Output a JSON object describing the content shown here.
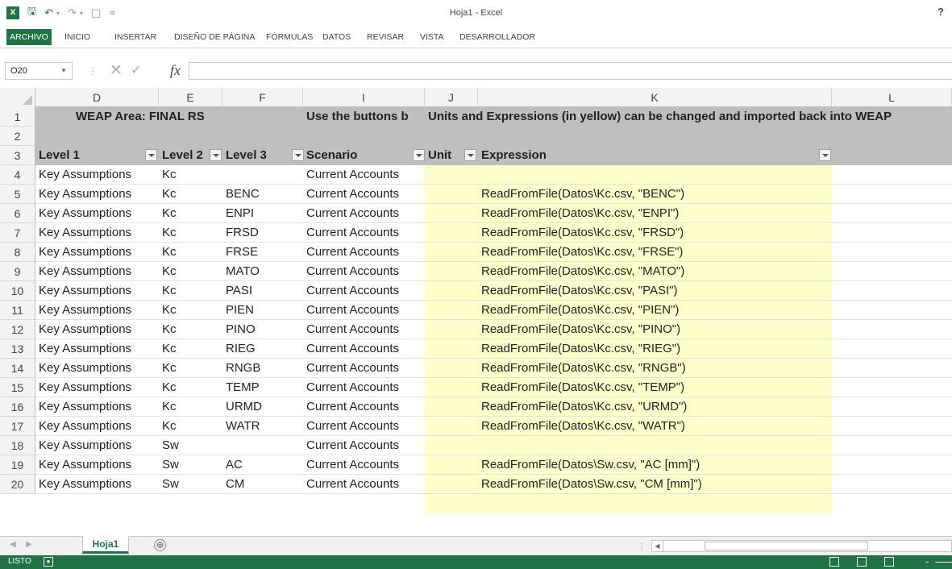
{
  "window": {
    "title": "Hoja1 - Excel",
    "help": "?",
    "logo": "X",
    "icons": [
      "save-icon",
      "undo-icon",
      "redo-icon",
      "new-document-icon",
      "customize-qat-icon"
    ]
  },
  "ribbon": {
    "tabs": [
      {
        "label": "ARCHIVO",
        "active": true
      },
      {
        "label": "INICIO"
      },
      {
        "label": "INSERTAR"
      },
      {
        "label": "DISEÑO DE PÁGINA"
      },
      {
        "label": "FÓRMULAS"
      },
      {
        "label": "DATOS"
      },
      {
        "label": "REVISAR"
      },
      {
        "label": "VISTA"
      },
      {
        "label": "DESARROLLADOR"
      }
    ]
  },
  "formula_bar": {
    "name_box": "O20",
    "fx": "fx",
    "value": ""
  },
  "columns": [
    "D",
    "E",
    "F",
    "I",
    "J",
    "K",
    "L"
  ],
  "rows": [
    {
      "n": "1",
      "cells": {
        "D": "WEAP Area: FINAL RS",
        "I": "Use the buttons b",
        "J": "Units and Expressions (in yellow) can be changed and imported back into WEAP"
      }
    },
    {
      "n": "2",
      "cells": {}
    },
    {
      "n": "3",
      "cells": {
        "D": "Level 1",
        "E": "Level 2",
        "F": "Level 3",
        "I": "Scenario",
        "J": "Unit",
        "K": "Expression"
      }
    },
    {
      "n": "4",
      "cells": {
        "D": "Key Assumptions",
        "E": "Kc",
        "F": "",
        "I": "Current Accounts",
        "K": ""
      }
    },
    {
      "n": "5",
      "cells": {
        "D": "Key Assumptions",
        "E": "Kc",
        "F": "BENC",
        "I": "Current Accounts",
        "K": "ReadFromFile(Datos\\Kc.csv, \"BENC\")"
      }
    },
    {
      "n": "6",
      "cells": {
        "D": "Key Assumptions",
        "E": "Kc",
        "F": "ENPI",
        "I": "Current Accounts",
        "K": "ReadFromFile(Datos\\Kc.csv, \"ENPI\")"
      }
    },
    {
      "n": "7",
      "cells": {
        "D": "Key Assumptions",
        "E": "Kc",
        "F": "FRSD",
        "I": "Current Accounts",
        "K": "ReadFromFile(Datos\\Kc.csv, \"FRSD\")"
      }
    },
    {
      "n": "8",
      "cells": {
        "D": "Key Assumptions",
        "E": "Kc",
        "F": "FRSE",
        "I": "Current Accounts",
        "K": "ReadFromFile(Datos\\Kc.csv, \"FRSE\")"
      }
    },
    {
      "n": "9",
      "cells": {
        "D": "Key Assumptions",
        "E": "Kc",
        "F": "MATO",
        "I": "Current Accounts",
        "K": "ReadFromFile(Datos\\Kc.csv, \"MATO\")"
      }
    },
    {
      "n": "10",
      "cells": {
        "D": "Key Assumptions",
        "E": "Kc",
        "F": "PASI",
        "I": "Current Accounts",
        "K": "ReadFromFile(Datos\\Kc.csv, \"PASI\")"
      }
    },
    {
      "n": "11",
      "cells": {
        "D": "Key Assumptions",
        "E": "Kc",
        "F": "PIEN",
        "I": "Current Accounts",
        "K": "ReadFromFile(Datos\\Kc.csv, \"PIEN\")"
      }
    },
    {
      "n": "12",
      "cells": {
        "D": "Key Assumptions",
        "E": "Kc",
        "F": "PINO",
        "I": "Current Accounts",
        "K": "ReadFromFile(Datos\\Kc.csv, \"PINO\")"
      }
    },
    {
      "n": "13",
      "cells": {
        "D": "Key Assumptions",
        "E": "Kc",
        "F": "RIEG",
        "I": "Current Accounts",
        "K": "ReadFromFile(Datos\\Kc.csv, \"RIEG\")"
      }
    },
    {
      "n": "14",
      "cells": {
        "D": "Key Assumptions",
        "E": "Kc",
        "F": "RNGB",
        "I": "Current Accounts",
        "K": "ReadFromFile(Datos\\Kc.csv, \"RNGB\")"
      }
    },
    {
      "n": "15",
      "cells": {
        "D": "Key Assumptions",
        "E": "Kc",
        "F": "TEMP",
        "I": "Current Accounts",
        "K": "ReadFromFile(Datos\\Kc.csv, \"TEMP\")"
      }
    },
    {
      "n": "16",
      "cells": {
        "D": "Key Assumptions",
        "E": "Kc",
        "F": "URMD",
        "I": "Current Accounts",
        "K": "ReadFromFile(Datos\\Kc.csv, \"URMD\")"
      }
    },
    {
      "n": "17",
      "cells": {
        "D": "Key Assumptions",
        "E": "Kc",
        "F": "WATR",
        "I": "Current Accounts",
        "K": "ReadFromFile(Datos\\Kc.csv, \"WATR\")"
      }
    },
    {
      "n": "18",
      "cells": {
        "D": "Key Assumptions",
        "E": "Sw",
        "F": "",
        "I": "Current Accounts",
        "K": ""
      }
    },
    {
      "n": "19",
      "cells": {
        "D": "Key Assumptions",
        "E": "Sw",
        "F": "AC",
        "I": "Current Accounts",
        "K": "ReadFromFile(Datos\\Sw.csv, \"AC [mm]\")"
      }
    },
    {
      "n": "20",
      "cells": {
        "D": "Key Assumptions",
        "E": "Sw",
        "F": "CM",
        "I": "Current Accounts",
        "K": "ReadFromFile(Datos\\Sw.csv, \"CM [mm]\")"
      }
    }
  ],
  "sheet_tabs": {
    "sheets": [
      "Hoja1"
    ],
    "add": "⊕"
  },
  "status_bar": {
    "status": "LISTO",
    "minus": "-"
  },
  "colors": {
    "excel_green": "#217346",
    "header_band": "#bfbfbf",
    "editable_yellow": "#ffffcc"
  }
}
